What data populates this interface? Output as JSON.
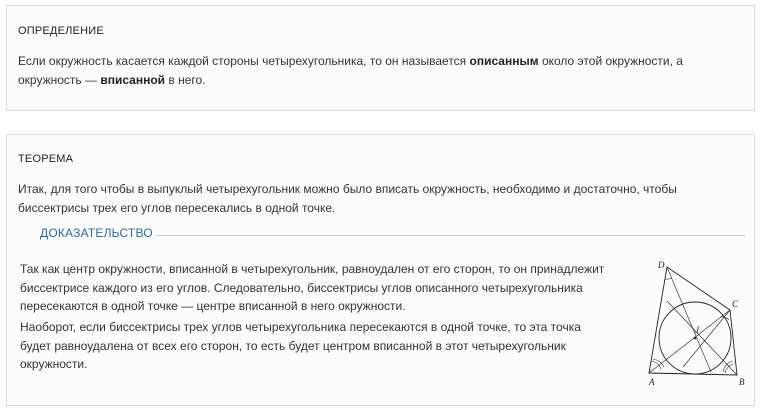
{
  "definition": {
    "heading": "ОПРЕДЕЛЕНИЕ",
    "text_part1": "Если окружность касается каждой стороны четырехугольника, то он называется ",
    "bold1": "описанным",
    "text_part2": " около этой окружности, а окружность — ",
    "bold2": "вписанной",
    "text_part3": " в него."
  },
  "theorem": {
    "heading": "ТЕОРЕМА",
    "text": "Итак, для того чтобы в выпуклый четырехугольник можно было вписать окружность, необходимо и достаточно, чтобы биссектрисы трех его углов пересекались в одной точке."
  },
  "proof": {
    "title": "ДОКАЗАТЕЛЬСТВО",
    "paragraph1": "Так как центр окружности, вписанной в четырехугольник, равноудален от его сторон, то он принадлежит биссектрисе каждого из его углов. Следовательно, биссектрисы углов описанного четырехугольника пересекаются в одной точке — центре вписанной в него окружности.",
    "paragraph2": "Наоборот, если биссектрисы трех углов четырехугольника пересекаются в одной точке, то эта точка будет равноудалена от всех его сторон, то есть будет центром вписанной в этот четырехугольник окружности."
  },
  "figure": {
    "labels": {
      "A": "A",
      "B": "B",
      "C": "C",
      "D": "D",
      "J": "J"
    }
  },
  "colors": {
    "accent": "#2a6aa3",
    "border": "#dadada"
  }
}
